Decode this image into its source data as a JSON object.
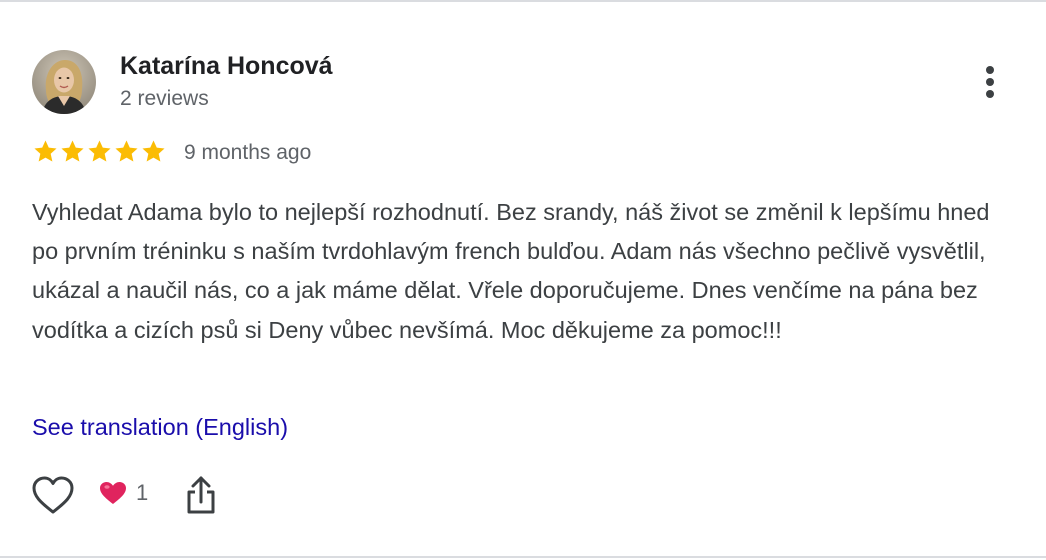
{
  "author": {
    "name": "Katarína Honcová",
    "reviews": "2 reviews"
  },
  "rating": {
    "stars": 5,
    "max": 5,
    "color": "#fbbc04"
  },
  "review": {
    "time": "9 months ago",
    "text": "Vyhledat Adama bylo to nejlepší rozhodnutí. Bez srandy, náš život se změnil k lepšímu hned po prvním tréninku s naším tvrdohlavým french bulďou. Adam nás všechno pečlivě vysvětlil, ukázal a naučil nás, co a jak máme dělat. Vřele doporučujeme. Dnes venčíme na pána bez vodítka a cizích psů si Deny vůbec nevšímá. Moc děkujeme za pomoc!!!",
    "translation_link": "See translation (English)"
  },
  "actions": {
    "like_icon": "heart-outline-icon",
    "reaction_icon": "red-heart-icon",
    "reaction_count": "1",
    "share_icon": "share-icon",
    "more_icon": "more-vert-icon"
  },
  "colors": {
    "link": "#1a0dab",
    "secondary_text": "#5f6368",
    "reaction_heart": "#e0245e"
  }
}
